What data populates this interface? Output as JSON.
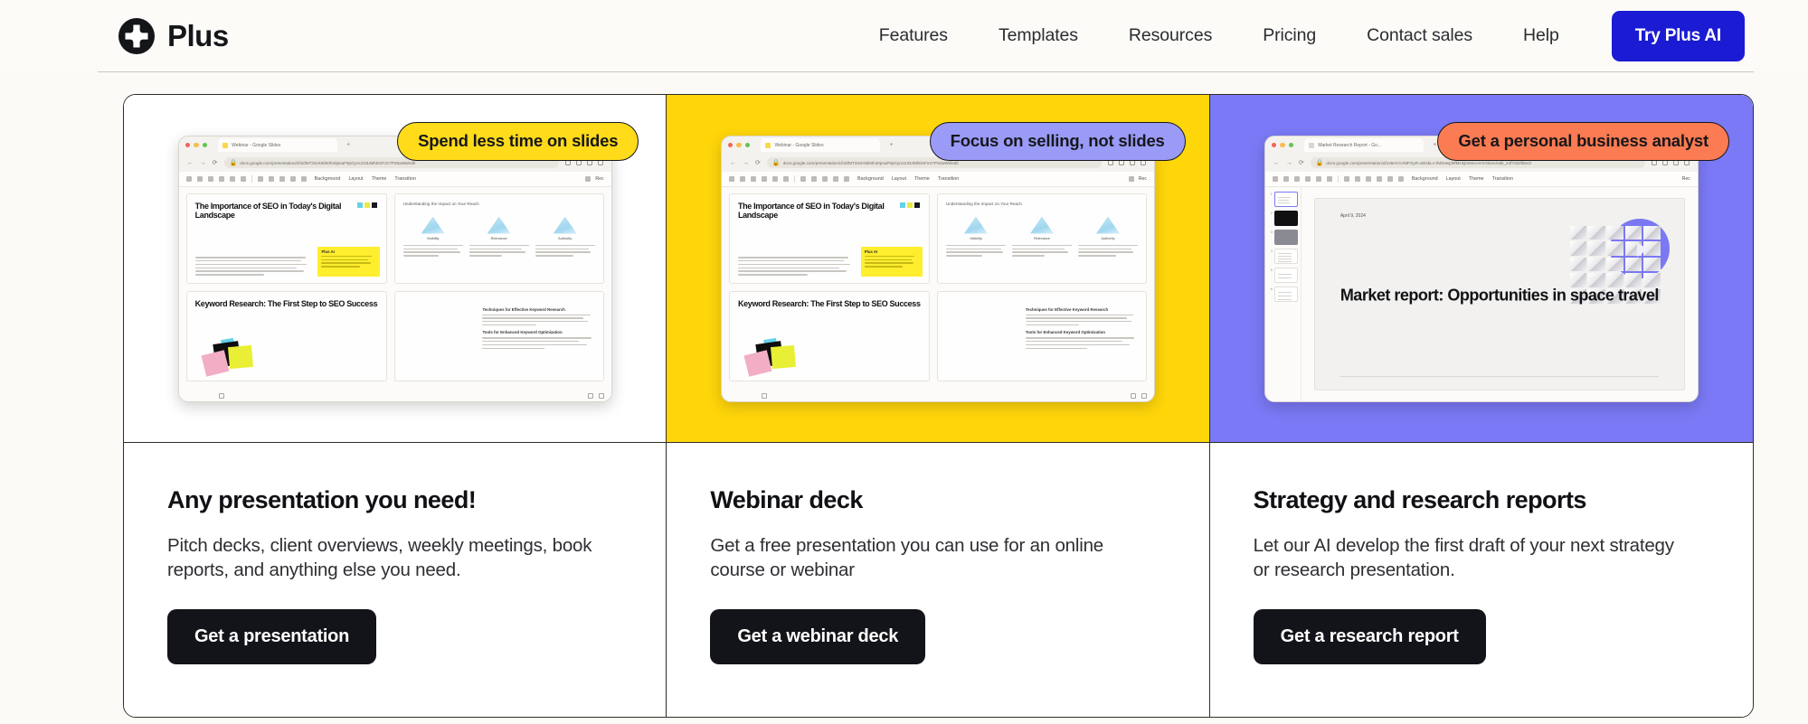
{
  "header": {
    "logo_icon": "plus-circle-logo-icon",
    "brand": "Plus",
    "nav": [
      {
        "label": "Features"
      },
      {
        "label": "Templates"
      },
      {
        "label": "Resources"
      },
      {
        "label": "Pricing"
      },
      {
        "label": "Contact sales"
      },
      {
        "label": "Help"
      }
    ],
    "cta_label": "Try Plus AI",
    "cta_color": "#1B1BD4"
  },
  "cards": [
    {
      "badge": "Spend less time on slides",
      "badge_bg": "#FFDB1A",
      "media_bg": "#FFFFFF",
      "title": "Any presentation you need!",
      "desc": "Pitch decks, client overviews, weekly meetings, book reports, and anything else you need.",
      "button": "Get a presentation",
      "browser": {
        "tab_title": "Webinar - Google Slides",
        "url": "docs.google.com/presentation/d/1kfMT33cK5bk0h40pnaF9pGynUz33JMhDsFnX7PS0aW8/edit",
        "menu": [
          "Background",
          "Layout",
          "Theme",
          "Transition"
        ],
        "record_label": "Rec",
        "slide1_title": "The Importance of SEO in Today's Digital Landscape",
        "slide2_title": "Keyword Research: The First Step to SEO Success",
        "slide1b_heading": "Understanding the Impact on Your Reach",
        "column_labels": [
          "Visibility",
          "Relevance",
          "Authority"
        ]
      }
    },
    {
      "badge": "Focus on selling, not slides",
      "badge_bg": "#9A9BF7",
      "media_bg": "#FFD60A",
      "title": "Webinar deck",
      "desc": "Get a free presentation you can use for an online course or webinar",
      "button": "Get a webinar deck",
      "browser": {
        "tab_title": "Webinar - Google Slides",
        "url": "docs.google.com/presentation/d/1kfMT33cK5bk0h40pnaF9pGynUz33JMhDsFnX7PS0aW8/edit",
        "menu": [
          "Background",
          "Layout",
          "Theme",
          "Transition"
        ],
        "record_label": "Rec",
        "slide1_title": "The Importance of SEO in Today's Digital Landscape",
        "slide2_title": "Keyword Research: The First Step to SEO Success",
        "slide1b_heading": "Understanding the Impact on Your Reach",
        "column_labels": [
          "Visibility",
          "Relevance",
          "Authority"
        ]
      }
    },
    {
      "badge": "Get a personal business analyst",
      "badge_bg": "#FB7B52",
      "media_bg": "#7B79F5",
      "title": "Strategy and research reports",
      "desc": "Let our AI develop the first draft of your next strategy or research presentation.",
      "button": "Get a research report",
      "browser": {
        "tab_title": "Market Research Report - Go...",
        "url": "docs.google.com/presentation/d/1s5HV1VMFGyR-utEsbLn-fM3Hwj39fMHQmNeAAHVGksA/edit_24f7d32fdec0",
        "menu": [
          "Background",
          "Layout",
          "Theme",
          "Transition"
        ],
        "record_label": "Rec",
        "slide_date": "April 9, 2024",
        "slide_title": "Market report: Opportunities in space travel"
      }
    }
  ]
}
